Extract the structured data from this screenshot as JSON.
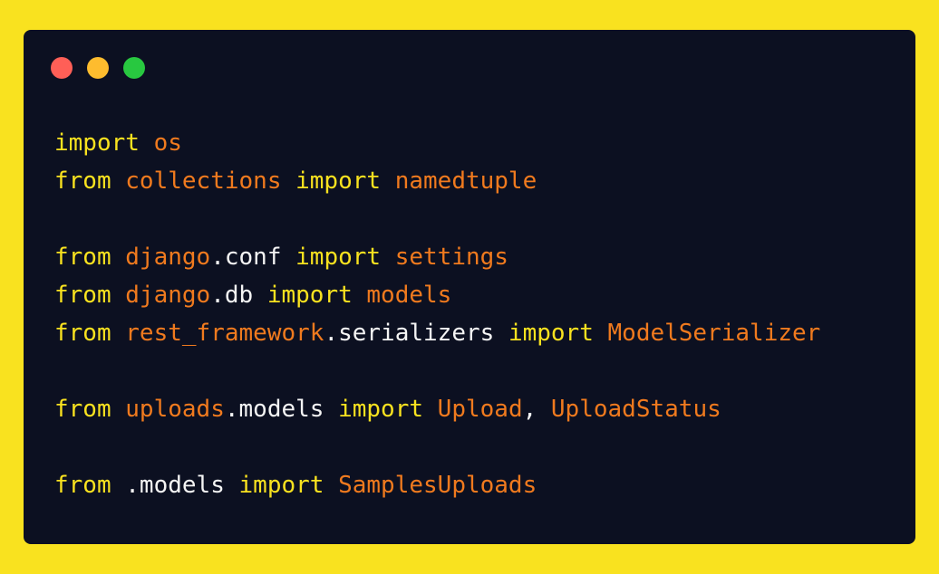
{
  "window": {
    "controls": [
      {
        "name": "close",
        "color": "#ff5f57"
      },
      {
        "name": "minimize",
        "color": "#febc2e"
      },
      {
        "name": "maximize",
        "color": "#28c840"
      }
    ]
  },
  "colors": {
    "background": "#f9e21f",
    "editor": "#0c1021",
    "keyword": "#f9e21f",
    "module": "#f07a1e",
    "plain": "#f4f4f4"
  },
  "code": {
    "lines": [
      [
        {
          "text": "import",
          "kind": "kw"
        },
        {
          "text": " ",
          "kind": "plain"
        },
        {
          "text": "os",
          "kind": "mod"
        }
      ],
      [
        {
          "text": "from",
          "kind": "kw"
        },
        {
          "text": " ",
          "kind": "plain"
        },
        {
          "text": "collections",
          "kind": "mod"
        },
        {
          "text": " ",
          "kind": "plain"
        },
        {
          "text": "import",
          "kind": "kw"
        },
        {
          "text": " ",
          "kind": "plain"
        },
        {
          "text": "namedtuple",
          "kind": "name"
        }
      ],
      [],
      [
        {
          "text": "from",
          "kind": "kw"
        },
        {
          "text": " ",
          "kind": "plain"
        },
        {
          "text": "django",
          "kind": "mod"
        },
        {
          "text": ".conf",
          "kind": "plain"
        },
        {
          "text": " ",
          "kind": "plain"
        },
        {
          "text": "import",
          "kind": "kw"
        },
        {
          "text": " ",
          "kind": "plain"
        },
        {
          "text": "settings",
          "kind": "name"
        }
      ],
      [
        {
          "text": "from",
          "kind": "kw"
        },
        {
          "text": " ",
          "kind": "plain"
        },
        {
          "text": "django",
          "kind": "mod"
        },
        {
          "text": ".db",
          "kind": "plain"
        },
        {
          "text": " ",
          "kind": "plain"
        },
        {
          "text": "import",
          "kind": "kw"
        },
        {
          "text": " ",
          "kind": "plain"
        },
        {
          "text": "models",
          "kind": "name"
        }
      ],
      [
        {
          "text": "from",
          "kind": "kw"
        },
        {
          "text": " ",
          "kind": "plain"
        },
        {
          "text": "rest_framework",
          "kind": "mod"
        },
        {
          "text": ".serializers",
          "kind": "plain"
        },
        {
          "text": " ",
          "kind": "plain"
        },
        {
          "text": "import",
          "kind": "kw"
        },
        {
          "text": " ",
          "kind": "plain"
        },
        {
          "text": "ModelSerializer",
          "kind": "name"
        }
      ],
      [],
      [
        {
          "text": "from",
          "kind": "kw"
        },
        {
          "text": " ",
          "kind": "plain"
        },
        {
          "text": "uploads",
          "kind": "mod"
        },
        {
          "text": ".models",
          "kind": "plain"
        },
        {
          "text": " ",
          "kind": "plain"
        },
        {
          "text": "import",
          "kind": "kw"
        },
        {
          "text": " ",
          "kind": "plain"
        },
        {
          "text": "Upload",
          "kind": "name"
        },
        {
          "text": ", ",
          "kind": "plain"
        },
        {
          "text": "UploadStatus",
          "kind": "name"
        }
      ],
      [],
      [
        {
          "text": "from",
          "kind": "kw"
        },
        {
          "text": " ",
          "kind": "plain"
        },
        {
          "text": ".models",
          "kind": "plain"
        },
        {
          "text": " ",
          "kind": "plain"
        },
        {
          "text": "import",
          "kind": "kw"
        },
        {
          "text": " ",
          "kind": "plain"
        },
        {
          "text": "SamplesUploads",
          "kind": "name"
        }
      ]
    ]
  }
}
